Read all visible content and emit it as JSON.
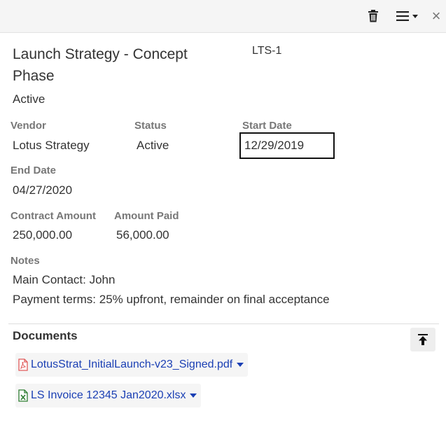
{
  "header": {
    "icons": {
      "delete": "trash-icon",
      "menu": "hamburger-menu-icon",
      "close": "close-icon"
    },
    "close_glyph": "×"
  },
  "record": {
    "title": "Launch Strategy - Concept Phase",
    "code": "LTS-1",
    "status": "Active"
  },
  "fields": {
    "vendor": {
      "label": "Vendor",
      "value": "Lotus Strategy"
    },
    "status": {
      "label": "Status",
      "value": "Active"
    },
    "start_date": {
      "label": "Start Date",
      "value": "12/29/2019"
    },
    "end_date": {
      "label": "End Date",
      "value": "04/27/2020"
    },
    "contract_amount": {
      "label": "Contract Amount",
      "value": "250,000.00"
    },
    "amount_paid": {
      "label": "Amount Paid",
      "value": "56,000.00"
    },
    "notes": {
      "label": "Notes",
      "line1": "Main Contact: John",
      "line2": "Payment terms: 25% upfront, remainder on final acceptance"
    }
  },
  "documents": {
    "title": "Documents",
    "upload_icon": "upload-to-top-icon",
    "items": [
      {
        "name": "LotusStrat_InitialLaunch-v23_Signed.pdf",
        "icon": "pdf-file-icon"
      },
      {
        "name": "LS Invoice 12345 Jan2020.xlsx",
        "icon": "excel-file-icon"
      }
    ]
  },
  "colors": {
    "link": "#1a3fb4",
    "label": "#777777",
    "pdf": "#e05a5a",
    "excel": "#2e7d32"
  }
}
